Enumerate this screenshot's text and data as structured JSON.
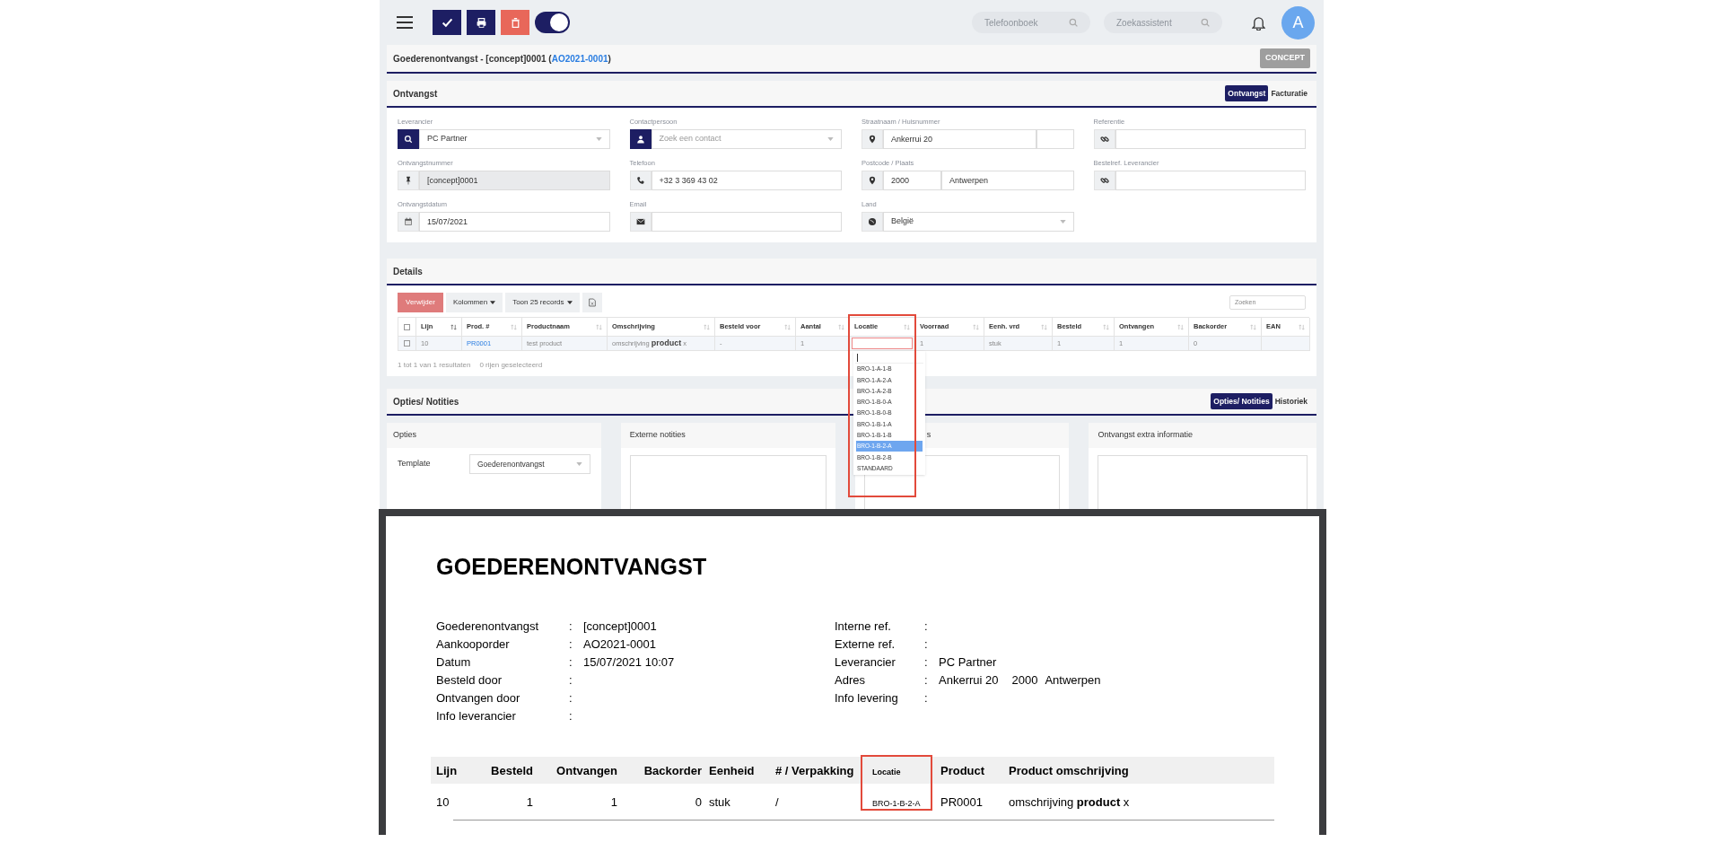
{
  "topbar": {
    "actions": [
      {
        "kind": "confirm"
      },
      {
        "kind": "print"
      },
      {
        "kind": "delete"
      }
    ],
    "toggle": {
      "on": true
    },
    "searches": [
      {
        "placeholder": "Telefoonboek"
      },
      {
        "placeholder": "Zoekassistent"
      }
    ],
    "avatar": "A"
  },
  "header": {
    "title": "Goederenontvangst - [concept]0001 (",
    "link": "AO2021-0001",
    "title_end": ")",
    "status": "CONCEPT"
  },
  "ontvangst": {
    "title": "Ontvangst",
    "tabs": [
      {
        "label": "Ontvangst",
        "selected": true
      },
      {
        "label": "Facturatie",
        "selected": false
      }
    ],
    "fields": [
      {
        "label": "Leverancier",
        "kind": "select",
        "value": "PC Partner",
        "disabled": false
      },
      {
        "label": "Contactpersoon",
        "kind": "select",
        "placeholder": "Zoek een contact",
        "disabled": false
      },
      {
        "label": "Straatnaam / Huisnummer",
        "kind": "pair",
        "value": "Ankerrui 20",
        "disabled": false
      },
      {
        "label": "Referentie",
        "kind": "input",
        "disabled": false
      },
      {
        "label": "Ontvangstnummer",
        "kind": "input",
        "value": "[concept]0001",
        "disabled": true
      },
      {
        "label": "Telefoon",
        "kind": "input",
        "value": "+32 3 369 43 02",
        "disabled": false
      },
      {
        "label": "Postcode / Plaats",
        "kind": "pair",
        "value": "2000",
        "value_2": "Antwerpen",
        "disabled": false
      },
      {
        "label": "Bestelref. Leverancier",
        "kind": "input",
        "disabled": false
      },
      {
        "label": "Ontvangstdatum",
        "kind": "input",
        "value": "15/07/2021",
        "disabled": false
      },
      {
        "label": "Email",
        "kind": "input",
        "disabled": false
      },
      {
        "label": "Land",
        "kind": "select",
        "value": "België",
        "disabled": false
      }
    ]
  },
  "details": {
    "title": "Details",
    "toolbar": [
      {
        "kind": "danger",
        "label": "Verwijder"
      },
      {
        "kind": "dropdown",
        "label": "Kolommen"
      },
      {
        "kind": "dropdown",
        "label": "Toon 25 records"
      },
      {
        "kind": "export"
      }
    ],
    "search": {
      "placeholder": "Zoeken"
    },
    "select_all": {
      "checked": false
    },
    "columns": [
      "Lijn",
      "Prod. #",
      "Productnaam",
      "Omschrijving",
      "Besteld voor",
      "Aantal",
      "Locatie",
      "Voorraad",
      "Eenh. vrd",
      "Besteld",
      "Ontvangen",
      "Backorder",
      "EAN"
    ],
    "rows": [
      {
        "checked": false,
        "cells": [
          {
            "kind": "text",
            "text": "10"
          },
          {
            "kind": "link",
            "text": "PR0001"
          },
          {
            "kind": "text",
            "text": "test product"
          },
          {
            "kind": "rich",
            "text": "omschrijving **product** x"
          },
          {
            "kind": "text",
            "text": "-"
          },
          {
            "kind": "text",
            "text": "1"
          },
          {
            "kind": "editor"
          },
          {
            "kind": "text",
            "text": "1"
          },
          {
            "kind": "text",
            "text": "stuk"
          },
          {
            "kind": "text",
            "text": "1"
          },
          {
            "kind": "text",
            "text": "1"
          },
          {
            "kind": "text",
            "text": "0"
          },
          {
            "kind": "empty"
          }
        ]
      }
    ],
    "dropdown": [
      {
        "label": "BRO-1-A-1-B",
        "selected": false
      },
      {
        "label": "BRO-1-A-2-A",
        "selected": false
      },
      {
        "label": "BRO-1-A-2-B",
        "selected": false
      },
      {
        "label": "BRO-1-B-0-A",
        "selected": false
      },
      {
        "label": "BRO-1-B-0-B",
        "selected": false
      },
      {
        "label": "BRO-1-B-1-A",
        "selected": false
      },
      {
        "label": "BRO-1-B-1-B",
        "selected": false
      },
      {
        "label": "BRO-1-B-2-A",
        "selected": true
      },
      {
        "label": "BRO-1-B-2-B",
        "selected": false
      },
      {
        "label": "STANDAARD",
        "selected": false
      }
    ],
    "summary": [
      "1 tot 1 van 1 resultaten",
      "0 rijen geselecteerd"
    ]
  },
  "opties": {
    "title": "Opties/ Notities",
    "tabs": [
      {
        "label": "Opties/ Notities",
        "selected": true
      },
      {
        "label": "Historiek",
        "selected": false
      }
    ],
    "options_panel": {
      "title": "Opties",
      "label": "Template",
      "value": "Goederenontvangst"
    },
    "panels": [
      {
        "title": "Externe notities"
      },
      {
        "title": "s"
      },
      {
        "title": "Ontvangst extra informatie"
      }
    ]
  },
  "document": {
    "title": "GOEDERENONTVANGST",
    "left": [
      {
        "label": "Goederenontvangst",
        "separator": ":",
        "value": "[concept]0001"
      },
      {
        "label": "Aankooporder",
        "separator": ":",
        "value": "AO2021-0001"
      },
      {
        "label": "Datum",
        "separator": ":",
        "value": "15/07/2021 10:07"
      },
      {
        "label": "Besteld door",
        "separator": ":"
      },
      {
        "label": "Ontvangen door",
        "separator": ":"
      },
      {
        "label": "Info leverancier",
        "separator": ":"
      }
    ],
    "right": [
      {
        "label": "Interne ref.",
        "separator": ":"
      },
      {
        "label": "Externe ref.",
        "separator": ":"
      },
      {
        "label": "Leverancier",
        "separator": ":",
        "value": "PC Partner"
      },
      {
        "label": "Adres",
        "separator": ":",
        "value": "Ankerrui 20",
        "value_2": "2000",
        "value_3": "Antwerpen"
      },
      {
        "label": "Info levering",
        "separator": ":"
      }
    ],
    "columns": [
      "Lijn",
      "Besteld",
      "Ontvangen",
      "Backorder",
      "Eenheid",
      "# / Verpakking",
      "Locatie",
      "Product",
      "Product omschrijving"
    ],
    "rows": [
      [
        "10",
        "1",
        "1",
        "0",
        "stuk",
        "/",
        "BRO-1-B-2-A",
        "PR0001",
        "omschrijving **product** x"
      ]
    ]
  }
}
